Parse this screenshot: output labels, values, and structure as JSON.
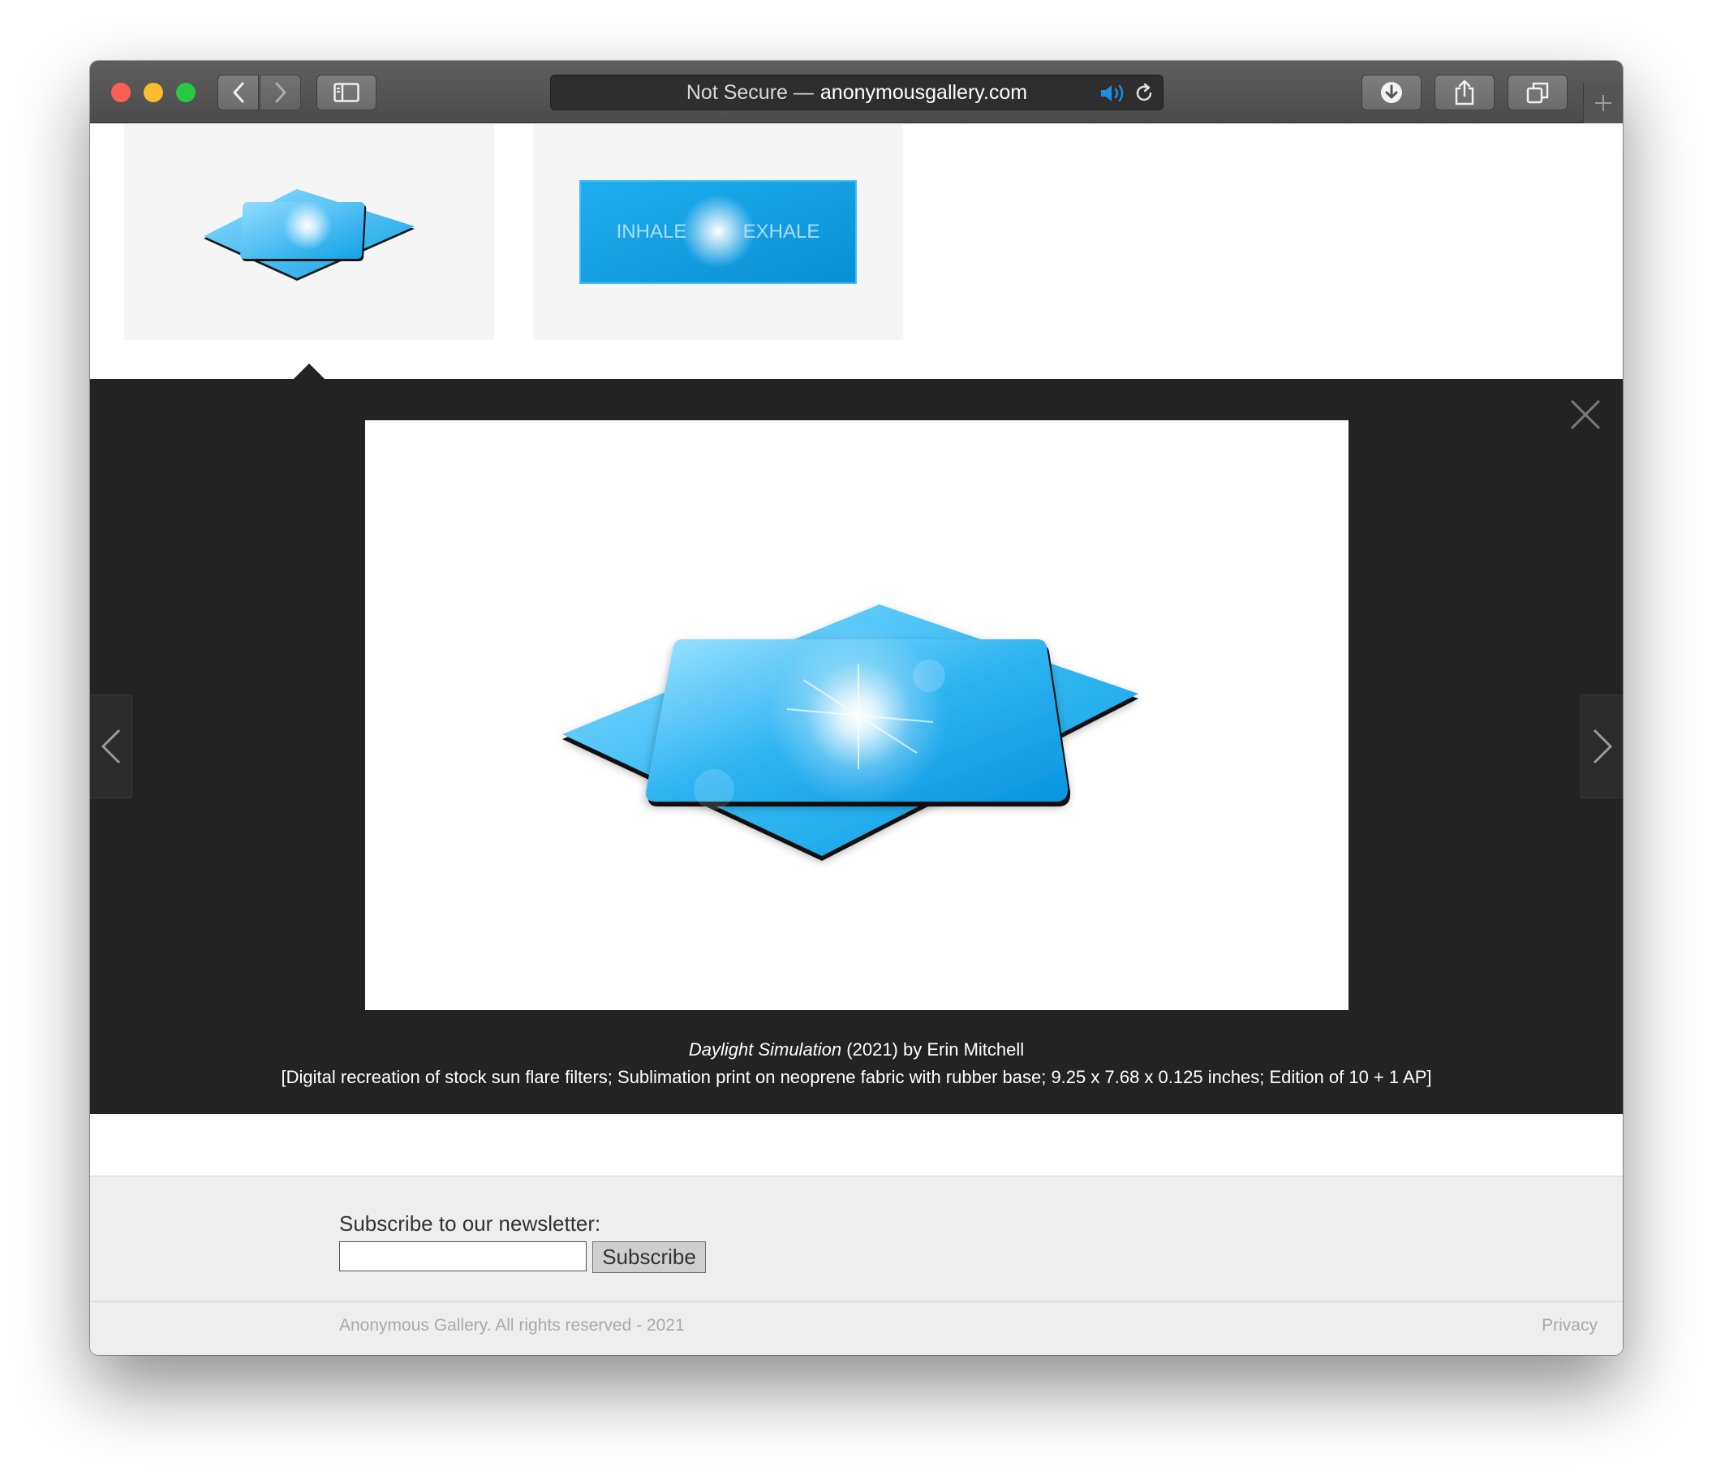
{
  "browser": {
    "url_prefix": "Not Secure —",
    "url_domain": "anonymousgallery.com"
  },
  "gallery": {
    "thumbnails": [
      {
        "alt": "mousepad-thumbnail"
      },
      {
        "alt": "banner-thumbnail"
      }
    ],
    "caption": {
      "title": "Daylight Simulation",
      "year_artist": "(2021) by Erin Mitchell",
      "details": "[Digital recreation of stock sun flare filters; Sublimation print on neoprene fabric with rubber base; 9.25 x 7.68 x 0.125 inches; Edition of 10 + 1 AP]"
    },
    "banner_text_left": "INHALE",
    "banner_text_right": "EXHALE"
  },
  "footer": {
    "newsletter_label": "Subscribe to our newsletter:",
    "newsletter_value": "",
    "subscribe_label": "Subscribe",
    "copyright": "Anonymous Gallery. All rights reserved - 2021",
    "privacy": "Privacy"
  },
  "colors": {
    "viewer_bg": "#232323",
    "accent_blue": "#1a8fe0",
    "traffic_red": "#fd5f57",
    "traffic_yellow": "#febc2e",
    "traffic_green": "#29c840"
  },
  "icons": [
    "back-icon",
    "forward-icon",
    "sidebar-icon",
    "audio-icon",
    "reload-icon",
    "download-icon",
    "share-icon",
    "tabs-icon",
    "plus-icon",
    "close-icon",
    "chevron-left-icon",
    "chevron-right-icon"
  ]
}
